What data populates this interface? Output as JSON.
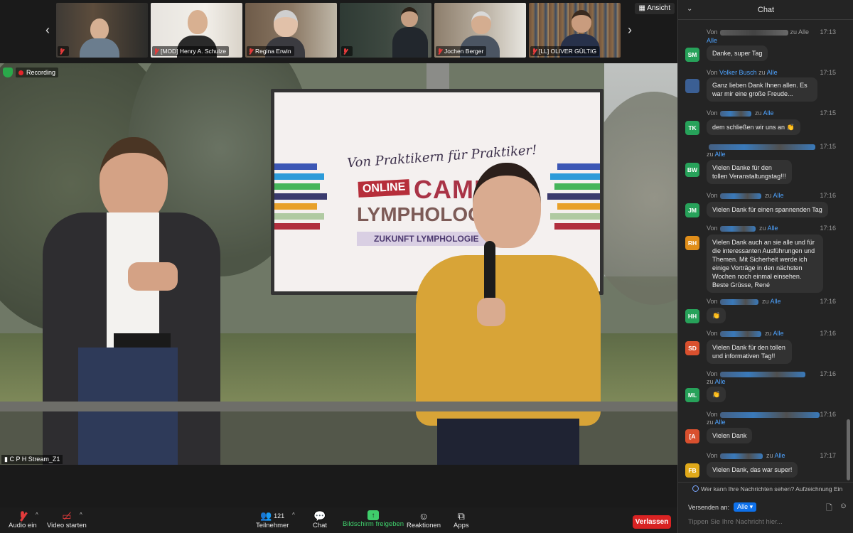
{
  "gallery": {
    "view_label": "Ansicht",
    "participants": [
      {
        "name": ""
      },
      {
        "name": "[MOD] Henry A. Schulze"
      },
      {
        "name": "Regina Erwin"
      },
      {
        "name": ""
      },
      {
        "name": "Jochen Berger"
      },
      {
        "name": "[LL] OLIVER GÜLTIG"
      }
    ]
  },
  "stage": {
    "recording_label": "Recording",
    "stream_label": "C P H Stream_Z1",
    "slide": {
      "slogan": "Von Praktikern für Praktiker!",
      "badge": "ONLINE",
      "title": "CAMP",
      "subtitle": "LYMPHOLOGIC",
      "tagline": "ZUKUNFT LYMPHOLOGIE"
    }
  },
  "toolbar": {
    "audio": "Audio ein",
    "video": "Video starten",
    "participants": "Teilnehmer",
    "participants_count": "121",
    "chat": "Chat",
    "share": "Bildschirm freigeben",
    "reactions": "Reaktionen",
    "apps": "Apps",
    "leave": "Verlassen"
  },
  "chat": {
    "title": "Chat",
    "messages": [
      {
        "from_prefix": "Von",
        "from": "",
        "to": "zu Alle",
        "time": "17:13",
        "avatar": "",
        "avatar_color": "",
        "text": ""
      },
      {
        "from_prefix": "",
        "from": "",
        "to": "",
        "time": "",
        "avatar": "SM",
        "avatar_color": "#27a25a",
        "text": "Danke, super Tag"
      },
      {
        "from_prefix": "Von",
        "from": "Volker Busch",
        "to": "Alle",
        "time": "17:15",
        "avatar": "",
        "avatar_color": "",
        "text": "Ganz lieben Dank Ihnen allen. Es war mir eine große Freude..."
      },
      {
        "from_prefix": "Von",
        "from": "",
        "to": "Alle",
        "time": "17:15",
        "avatar": "TK",
        "avatar_color": "#27a25a",
        "text": "dem schließen wir uns an 👏"
      },
      {
        "from_prefix": "",
        "from": "",
        "to": "Alle",
        "time": "17:15",
        "avatar": "BW",
        "avatar_color": "#27a25a",
        "text": "Vielen Danke für den tollen Veranstaltungstag!!!"
      },
      {
        "from_prefix": "Von",
        "from": "",
        "to": "Alle",
        "time": "17:16",
        "avatar": "JM",
        "avatar_color": "#27a25a",
        "text": "Vielen Dank für einen spannenden Tag"
      },
      {
        "from_prefix": "Von",
        "from": "",
        "to": "Alle",
        "time": "17:16",
        "avatar": "RH",
        "avatar_color": "#e08e1a",
        "text": "Vielen Dank auch an sie alle und für die interessanten Ausführungen und Themen. Mit Sicherheit werde ich einige Vorträge in den nächsten Wochen noch einmal einsehen. Beste Grüsse, René"
      },
      {
        "from_prefix": "Von",
        "from": "",
        "to": "Alle",
        "time": "17:16",
        "avatar": "HH",
        "avatar_color": "#27a25a",
        "text": "👏"
      },
      {
        "from_prefix": "Von",
        "from": "",
        "to": "Alle",
        "time": "17:16",
        "avatar": "SD",
        "avatar_color": "#d9502e",
        "text": "Vielen Dank für den tollen und informativen Tag!!"
      },
      {
        "from_prefix": "Von",
        "from": "",
        "to": "Alle",
        "time": "17:16",
        "avatar": "ML",
        "avatar_color": "#27a25a",
        "text": "👏"
      },
      {
        "from_prefix": "Von",
        "from": "",
        "to": "Alle",
        "time": "17:16",
        "avatar": "[A",
        "avatar_color": "#d9502e",
        "text": "Vielen Dank"
      },
      {
        "from_prefix": "Von",
        "from": "",
        "to": "Alle",
        "time": "17:17",
        "avatar": "FB",
        "avatar_color": "#e0a91a",
        "text": "Vielen Dank, das war super!"
      }
    ],
    "privacy_note": "Wer kann Ihre Nachrichten sehen? Aufzeichnung Ein",
    "send_to_label": "Versenden an:",
    "send_to_value": "Alle",
    "input_placeholder": "Tippen Sie Ihre Nachricht hier..."
  }
}
